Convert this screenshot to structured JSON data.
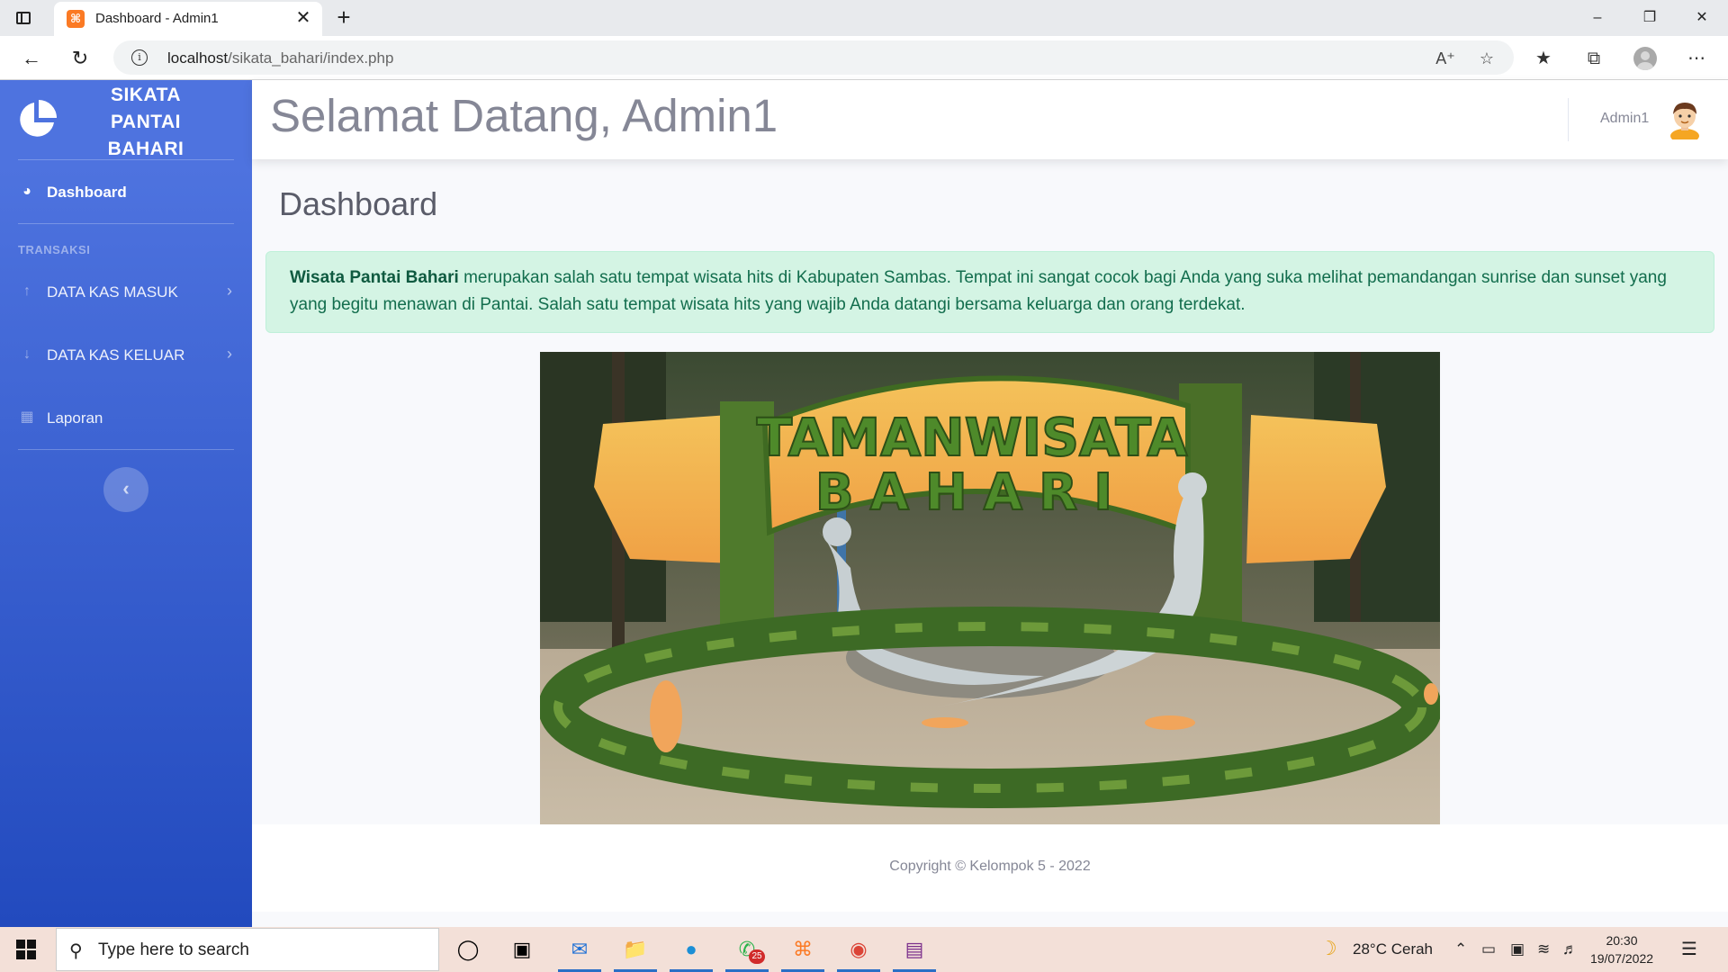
{
  "browser": {
    "tab_title": "Dashboard - Admin1",
    "tab_favicon_glyph": "⌘",
    "new_tab_glyph": "+",
    "close_glyph": "✕",
    "url_host": "localhost",
    "url_path": "/sikata_bahari/index.php",
    "window_controls": {
      "minimize": "–",
      "restore": "❐",
      "close": "✕"
    }
  },
  "sidebar": {
    "brand_line1": "SIKATA",
    "brand_line2": "PANTAI",
    "brand_line3": "BAHARI",
    "dashboard_label": "Dashboard",
    "section_heading": "TRANSAKSI",
    "items": [
      {
        "label": "DATA KAS MASUK",
        "icon": "arrow-up-icon"
      },
      {
        "label": "DATA KAS KELUAR",
        "icon": "arrow-down-icon"
      },
      {
        "label": "Laporan",
        "icon": "table-icon"
      }
    ],
    "toggle_glyph": "‹"
  },
  "topbar": {
    "welcome": "Selamat Datang, Admin1",
    "username": "Admin1"
  },
  "main": {
    "page_title": "Dashboard",
    "alert_bold": "Wisata Pantai Bahari",
    "alert_text": " merupakan salah satu tempat wisata hits di Kabupaten Sambas. Tempat ini sangat cocok bagi Anda yang suka melihat pemandangan sunrise dan sunset yang yang begitu menawan di Pantai. Salah satu tempat wisata hits yang wajib Anda datangi bersama keluarga dan orang terdekat.",
    "hero_sign_line1": "TAMANWISATA",
    "hero_sign_line2": "BAHARI"
  },
  "footer": {
    "copyright": "Copyright © Kelompok 5 - 2022"
  },
  "taskbar": {
    "search_placeholder": "Type here to search",
    "whatsapp_badge": "25",
    "weather": "28°C  Cerah",
    "time": "20:30",
    "date": "19/07/2022"
  },
  "colors": {
    "sidebar_gradient_top": "#4e73df",
    "sidebar_gradient_bottom": "#224abe",
    "alert_bg": "#d4f4e4",
    "alert_text": "#126d4d",
    "text_muted": "#858796"
  }
}
